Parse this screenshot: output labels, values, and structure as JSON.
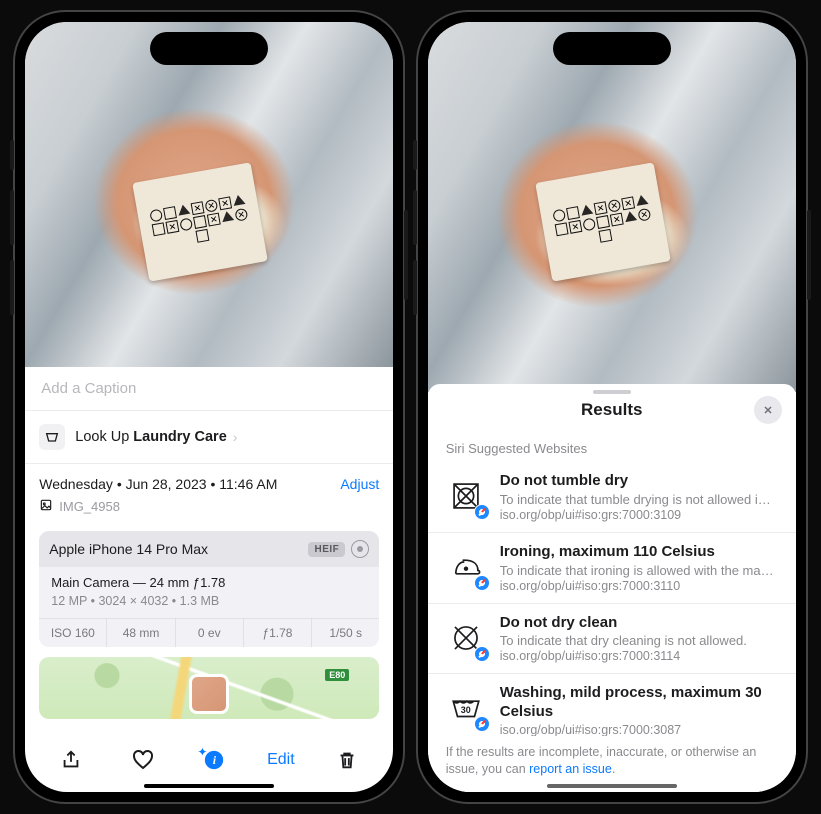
{
  "left": {
    "caption_placeholder": "Add a Caption",
    "lookup": {
      "prefix": "Look Up ",
      "term": "Laundry Care"
    },
    "meta": {
      "datetime": "Wednesday • Jun 28, 2023 • 11:46 AM",
      "adjust": "Adjust",
      "filename": "IMG_4958"
    },
    "camera": {
      "device": "Apple iPhone 14 Pro Max",
      "badge": "HEIF",
      "line1": "Main Camera — 24 mm ƒ1.78",
      "line2": "12 MP  •  3024 × 4032  •  1.3 MB",
      "strip": [
        "ISO 160",
        "48 mm",
        "0 ev",
        "ƒ1.78",
        "1/50 s"
      ]
    },
    "map": {
      "road": "E80"
    },
    "toolbar": {
      "edit": "Edit"
    }
  },
  "right": {
    "title": "Results",
    "section": "Siri Suggested Websites",
    "items": [
      {
        "title": "Do not tumble dry",
        "desc": "To indicate that tumble drying is not allowed in the…",
        "url": "iso.org/obp/ui#iso:grs:7000:3109"
      },
      {
        "title": "Ironing, maximum 110 Celsius",
        "desc": "To indicate that ironing is allowed with the maximu…",
        "url": "iso.org/obp/ui#iso:grs:7000:3110"
      },
      {
        "title": "Do not dry clean",
        "desc": "To indicate that dry cleaning is not allowed.",
        "url": "iso.org/obp/ui#iso:grs:7000:3114"
      },
      {
        "title": "Washing, mild process, maximum 30 Celsius",
        "desc": "",
        "url": "iso.org/obp/ui#iso:grs:7000:3087"
      }
    ],
    "wash_label": "30",
    "footer": {
      "text_a": "If the results are incomplete, inaccurate, or otherwise an issue, you can ",
      "link": "report an issue",
      "text_b": "."
    }
  }
}
